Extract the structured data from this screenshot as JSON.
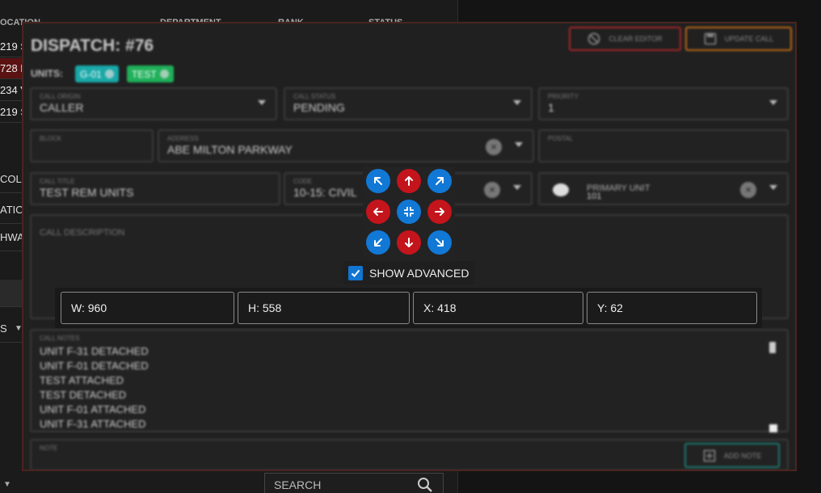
{
  "background": {
    "headers": [
      "OCATION",
      "DEPARTMENT",
      "RANK",
      "STATUS"
    ],
    "rows": [
      "219 S",
      "728 E",
      "234 V",
      "219 S"
    ],
    "side_items": [
      "COLU",
      "ATIO",
      "HWA",
      "",
      "S"
    ],
    "search_label": "SEARCH"
  },
  "modal": {
    "title": "DISPATCH: #76",
    "clear_editor_label": "CLEAR EDITOR",
    "update_call_label": "UPDATE CALL",
    "units_label": "UNITS:",
    "units": [
      {
        "label": "G-01",
        "color": "#1aa8a8"
      },
      {
        "label": "TEST",
        "color": "#1fb05a"
      }
    ],
    "fields": {
      "call_origin": {
        "label": "CALL ORIGIN",
        "value": "CALLER"
      },
      "call_status": {
        "label": "CALL STATUS",
        "value": "PENDING"
      },
      "priority": {
        "label": "PRIORITY",
        "value": "1"
      },
      "block": {
        "label": "BLOCK",
        "value": ""
      },
      "address": {
        "label": "ADDRESS",
        "value": "ABE MILTON PARKWAY"
      },
      "postal": {
        "label": "POSTAL",
        "value": ""
      },
      "call_title": {
        "label": "CALL TITLE",
        "value": "TEST REM UNITS"
      },
      "code": {
        "label": "CODE",
        "value": "10-15: CIVIL"
      },
      "primary_unit": {
        "label": "PRIMARY UNIT",
        "value": "101"
      },
      "call_description": {
        "label": "CALL DESCRIPTION",
        "value": ""
      },
      "call_notes": {
        "label": "CALL NOTES"
      },
      "note": {
        "label": "NOTE",
        "value": ""
      }
    },
    "notes": [
      "UNIT F-31 DETACHED",
      "UNIT F-01 DETACHED",
      "TEST ATTACHED",
      "TEST DETACHED",
      "UNIT F-01 ATTACHED",
      "UNIT F-31 ATTACHED"
    ],
    "add_note_label": "ADD NOTE"
  },
  "controls": {
    "show_advanced_label": "SHOW ADVANCED",
    "show_advanced_checked": true,
    "geometry": {
      "width": "W: 960",
      "height": "H: 558",
      "x": "X: 418",
      "y": "Y: 62"
    }
  },
  "colors": {
    "accent_blue": "#1178d6",
    "accent_red": "#c4141c",
    "clear_border": "#a9262a",
    "update_border": "#c06a14",
    "add_note_border": "#1c7a70"
  }
}
